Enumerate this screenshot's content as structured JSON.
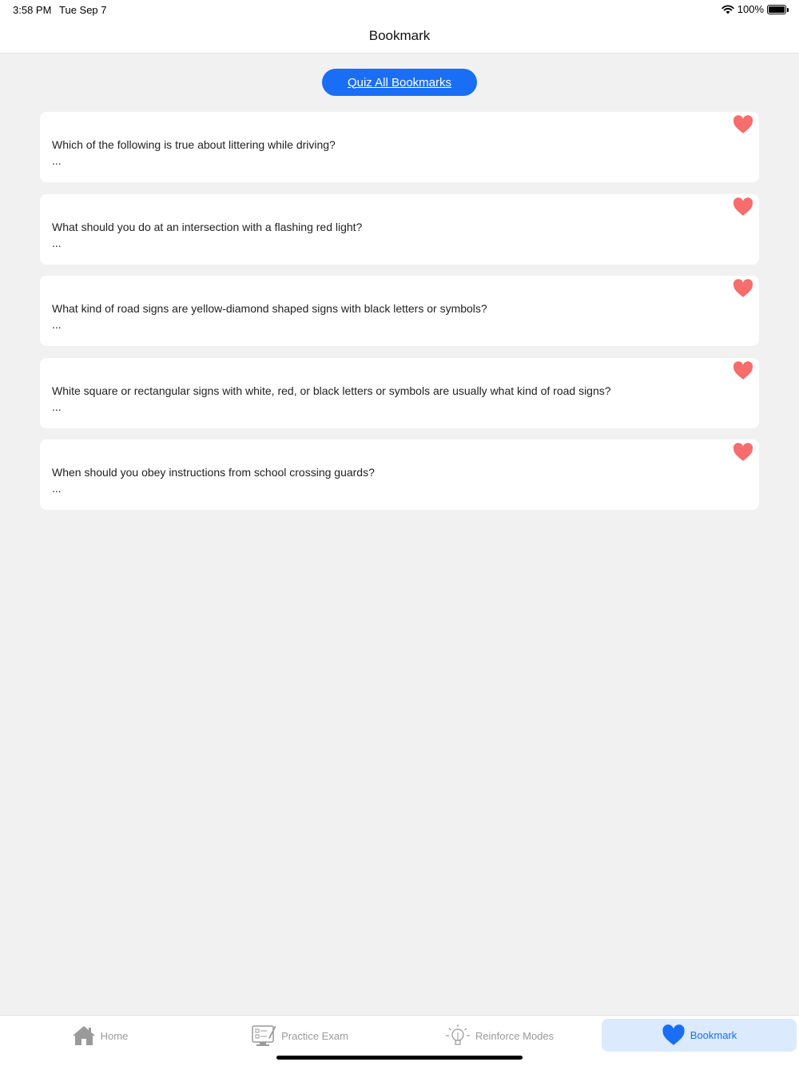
{
  "status": {
    "time": "3:58 PM",
    "date": "Tue Sep 7",
    "battery": "100%"
  },
  "header": {
    "title": "Bookmark"
  },
  "quiz_button": {
    "label": "Quiz All Bookmarks"
  },
  "bookmarks": [
    {
      "question": "Which of the following is true about littering while driving?",
      "ellipsis": "..."
    },
    {
      "question": "What should you do at an intersection with a flashing red light?",
      "ellipsis": "..."
    },
    {
      "question": "What kind of road signs are yellow-diamond shaped signs with black letters or symbols?",
      "ellipsis": "..."
    },
    {
      "question": "White square or rectangular signs with white, red, or black letters or symbols are usually what kind of road signs?",
      "ellipsis": "..."
    },
    {
      "question": "When should you obey instructions from school crossing guards?",
      "ellipsis": "..."
    }
  ],
  "tabs": [
    {
      "label": "Home",
      "icon": "home-icon"
    },
    {
      "label": "Practice Exam",
      "icon": "practice-exam-icon"
    },
    {
      "label": "Reinforce Modes",
      "icon": "lightbulb-icon"
    },
    {
      "label": "Bookmark",
      "icon": "heart-icon",
      "active": true
    }
  ],
  "colors": {
    "accent": "#1a6ef5",
    "heart": "#f76c6c",
    "background": "#f1f1f1"
  }
}
